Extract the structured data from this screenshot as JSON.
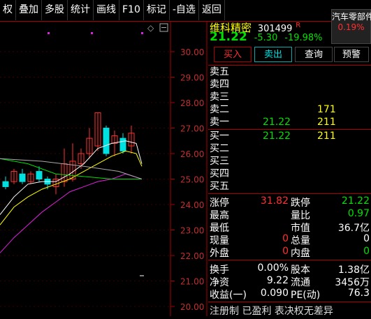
{
  "toolbar": {
    "items": [
      "权",
      "叠加",
      "多股",
      "统计",
      "画线",
      "F10",
      "标记",
      "-自选",
      "返回"
    ]
  },
  "chart": {
    "price_labels": [
      "30.00",
      "29.00",
      "28.00",
      "27.00",
      "26.00",
      "25.00",
      "24.00",
      "23.00",
      "22.00",
      "21.00",
      "20.00"
    ],
    "colors": {
      "up": "#ff3030",
      "down": "#00e0e0",
      "ma5": "#ffffff",
      "ma10": "#ffff00",
      "ma20": "#e020e0",
      "ma30": "#00e000"
    }
  },
  "quote": {
    "name": "维科精密",
    "code": "301499",
    "badge": "R",
    "price": "21.22",
    "change": "-5.30",
    "pct": "-19.98%",
    "sector_name": "汽车零部件",
    "sector_pct": "0.19%"
  },
  "actions": {
    "buy": "买入",
    "sell": "卖出",
    "query": "查询",
    "alert": "预警"
  },
  "orderbook": {
    "sell": [
      {
        "label": "卖五",
        "price": "",
        "vol": ""
      },
      {
        "label": "卖四",
        "price": "",
        "vol": ""
      },
      {
        "label": "卖三",
        "price": "",
        "vol": ""
      },
      {
        "label": "卖二",
        "price": "",
        "vol": "171"
      },
      {
        "label": "卖一",
        "price": "21.22",
        "vol": "211"
      }
    ],
    "buy": [
      {
        "label": "买一",
        "price": "21.22",
        "vol": "211"
      },
      {
        "label": "买二",
        "price": "",
        "vol": ""
      },
      {
        "label": "买三",
        "price": "",
        "vol": ""
      },
      {
        "label": "买四",
        "price": "",
        "vol": ""
      },
      {
        "label": "买五",
        "price": "",
        "vol": ""
      }
    ]
  },
  "stats": {
    "limit_up_label": "涨停",
    "limit_up": "31.82",
    "limit_down_label": "跌停",
    "limit_down": "21.22",
    "high_label": "最高",
    "high": "",
    "vol_ratio_label": "量比",
    "vol_ratio": "0.97",
    "low_label": "最低",
    "low": "",
    "mktcap_label": "市值",
    "mktcap": "36.7亿",
    "now_vol_label": "现量",
    "now_vol": "0",
    "total_vol_label": "总量",
    "total_vol": "0",
    "outer_label": "外盘",
    "outer": "0",
    "inner_label": "内盘",
    "inner": "0",
    "turnover_label": "换手",
    "turnover": "0.00%",
    "shares_label": "股本",
    "shares": "1.38亿",
    "nav_label": "净资",
    "nav": "9.22",
    "float_label": "流通",
    "float": "3456万",
    "eps_label": "收益(一)",
    "eps": "0.090",
    "pe_label": "PE(动)",
    "pe": "76.3"
  },
  "footer_text": "注册制 已盈利 表决权无差异"
}
